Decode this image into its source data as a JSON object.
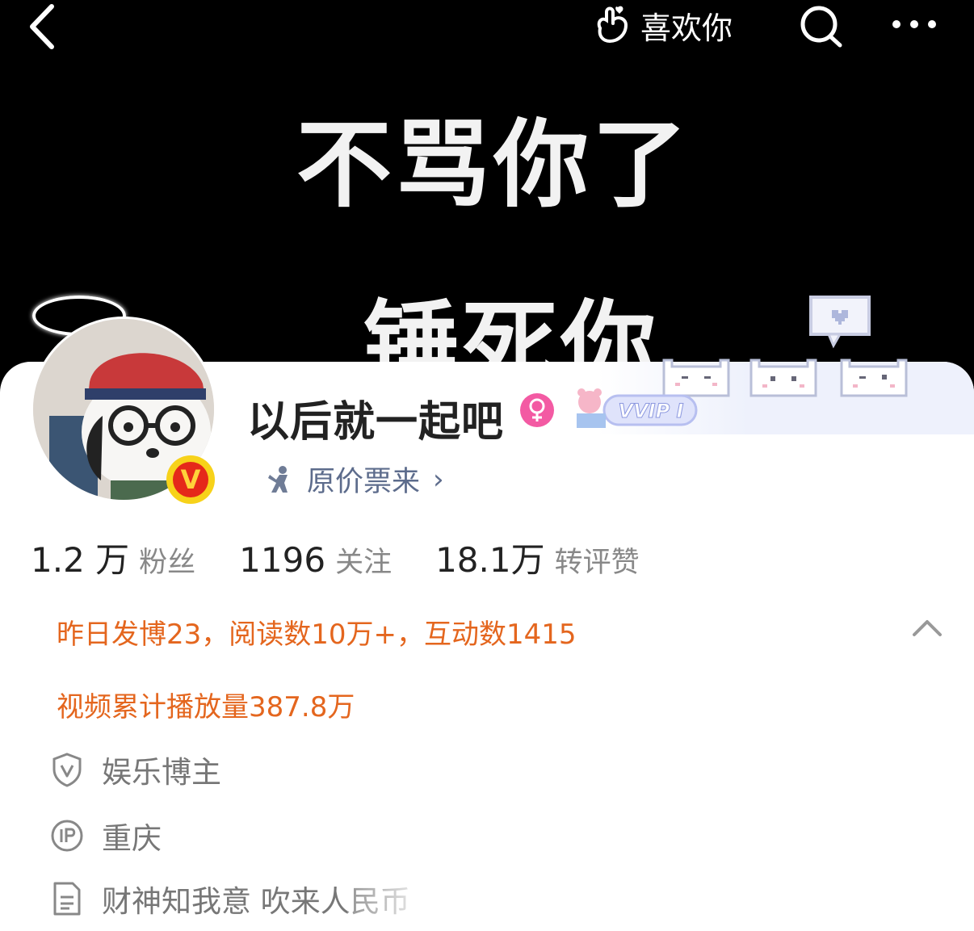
{
  "cover": {
    "line1": "不骂你了",
    "line2": "锤死你"
  },
  "topbar": {
    "like_label": "喜欢你"
  },
  "profile": {
    "username": "以后就一起吧",
    "vvip_label": "VVIP I",
    "verified_letter": "V",
    "tag_label": "原价票来",
    "tag_chevron": "›"
  },
  "stats": [
    {
      "value": "1.2 万",
      "label": "粉丝"
    },
    {
      "value": "1196",
      "label": "关注"
    },
    {
      "value": "18.1万",
      "label": "转评赞"
    }
  ],
  "highlights": {
    "line1": "昨日发博23，阅读数10万+，互动数1415",
    "line2": "视频累计播放量387.8万"
  },
  "info": {
    "category": "娱乐博主",
    "ip_location": "重庆",
    "bio": "财神知我意 吹来人民币"
  },
  "colors": {
    "accent_orange": "#e4661e",
    "tag_blue": "#5d6c8c",
    "gender_pink": "#f35aa3"
  }
}
